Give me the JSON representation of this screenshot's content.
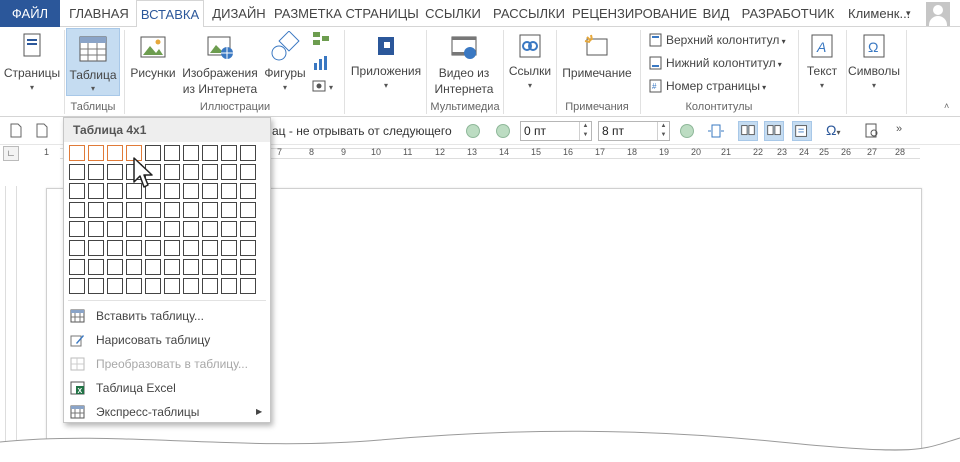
{
  "tabs": {
    "file": "ФАЙЛ",
    "items": [
      "ГЛАВНАЯ",
      "ВСТАВКА",
      "ДИЗАЙН",
      "РАЗМЕТКА СТРАНИЦЫ",
      "ССЫЛКИ",
      "РАССЫЛКИ",
      "РЕЦЕНЗИРОВАНИЕ",
      "ВИД",
      "РАЗРАБОТЧИК"
    ],
    "active": "ВСТАВКА",
    "user": "Клименк..."
  },
  "ribbon": {
    "pages": "Страницы",
    "table": "Таблица",
    "pictures": "Рисунки",
    "online_pictures_1": "Изображения",
    "online_pictures_2": "из Интернета",
    "shapes": "Фигуры",
    "apps": "Приложения",
    "online_video_1": "Видео из",
    "online_video_2": "Интернета",
    "links": "Ссылки",
    "comment": "Примечание",
    "header": "Верхний колонтитул",
    "footer": "Нижний колонтитул",
    "page_number": "Номер страницы",
    "text": "Текст",
    "symbols": "Символы",
    "groups": {
      "tables": "Таблицы",
      "illustrations": "Иллюстрации",
      "multimedia": "Мультимедиа",
      "comments": "Примечания",
      "header_footer": "Колонтитулы"
    }
  },
  "quickbar": {
    "paragraph_text": "ац - не отрывать от следующего",
    "spacing_before": "0 пт",
    "spacing_after": "8 пт"
  },
  "ruler": {
    "numbers": [
      "1",
      "7",
      "8",
      "9",
      "10",
      "11",
      "12",
      "13",
      "14",
      "15",
      "16",
      "17",
      "18",
      "19",
      "20",
      "21",
      "22",
      "23",
      "24",
      "25",
      "26",
      "27",
      "28"
    ]
  },
  "dropdown": {
    "title": "Таблица 4x1",
    "grid_columns": 10,
    "grid_rows": 8,
    "selected_columns": 4,
    "selected_rows": 1,
    "items": [
      {
        "label": "Вставить таблицу...",
        "icon": "table-icon",
        "disabled": false,
        "submenu": false
      },
      {
        "label": "Нарисовать таблицу",
        "icon": "pencil-table-icon",
        "disabled": false,
        "submenu": false
      },
      {
        "label": "Преобразовать в таблицу...",
        "icon": "convert-table-icon",
        "disabled": true,
        "submenu": false
      },
      {
        "label": "Таблица Excel",
        "icon": "excel-icon",
        "disabled": false,
        "submenu": false
      },
      {
        "label": "Экспресс-таблицы",
        "icon": "quick-tables-icon",
        "disabled": false,
        "submenu": true
      }
    ]
  },
  "colors": {
    "accent": "#2b579a",
    "selection": "#c5dcf1",
    "grid_highlight": "#e07b39"
  }
}
